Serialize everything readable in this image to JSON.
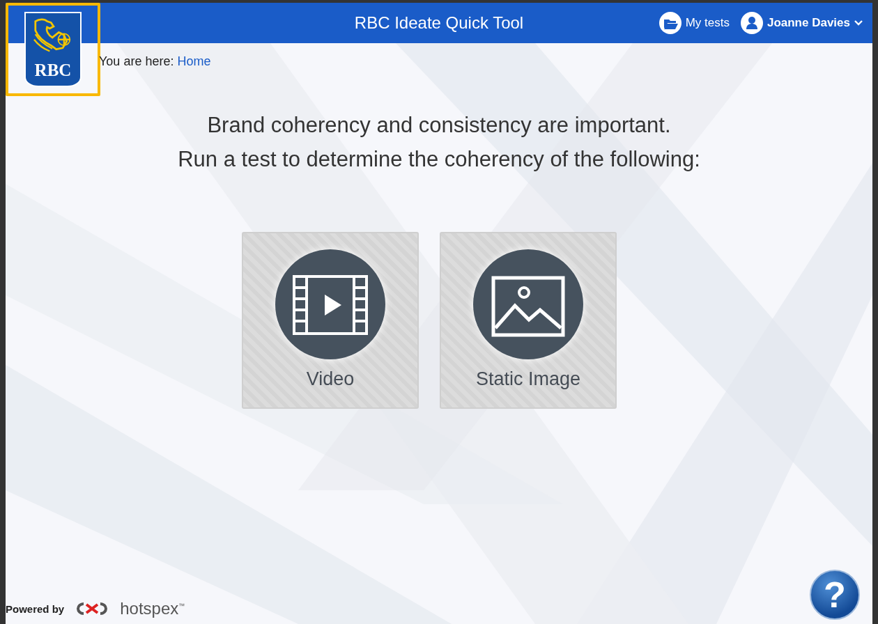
{
  "header": {
    "logo": {
      "text": "RBC",
      "highlighted": true
    },
    "title": "RBC Ideate Quick Tool",
    "links": [
      {
        "label": "My tests",
        "kind": "folder"
      },
      {
        "label": "Joanne Davies",
        "kind": "user"
      }
    ]
  },
  "breadcrumb": {
    "prefix": "You are here:",
    "link": "Home"
  },
  "heading": [
    "Brand coherency and consistency are important.",
    "Run a test to determine the coherency of the following:"
  ],
  "options": [
    {
      "label": "Video",
      "kind": "video"
    },
    {
      "label": "Static Image",
      "kind": "image"
    }
  ],
  "footer": {
    "powered_by": "Powered by",
    "brand": "hotspex",
    "trademark": "™"
  },
  "help": {
    "label": "?"
  }
}
